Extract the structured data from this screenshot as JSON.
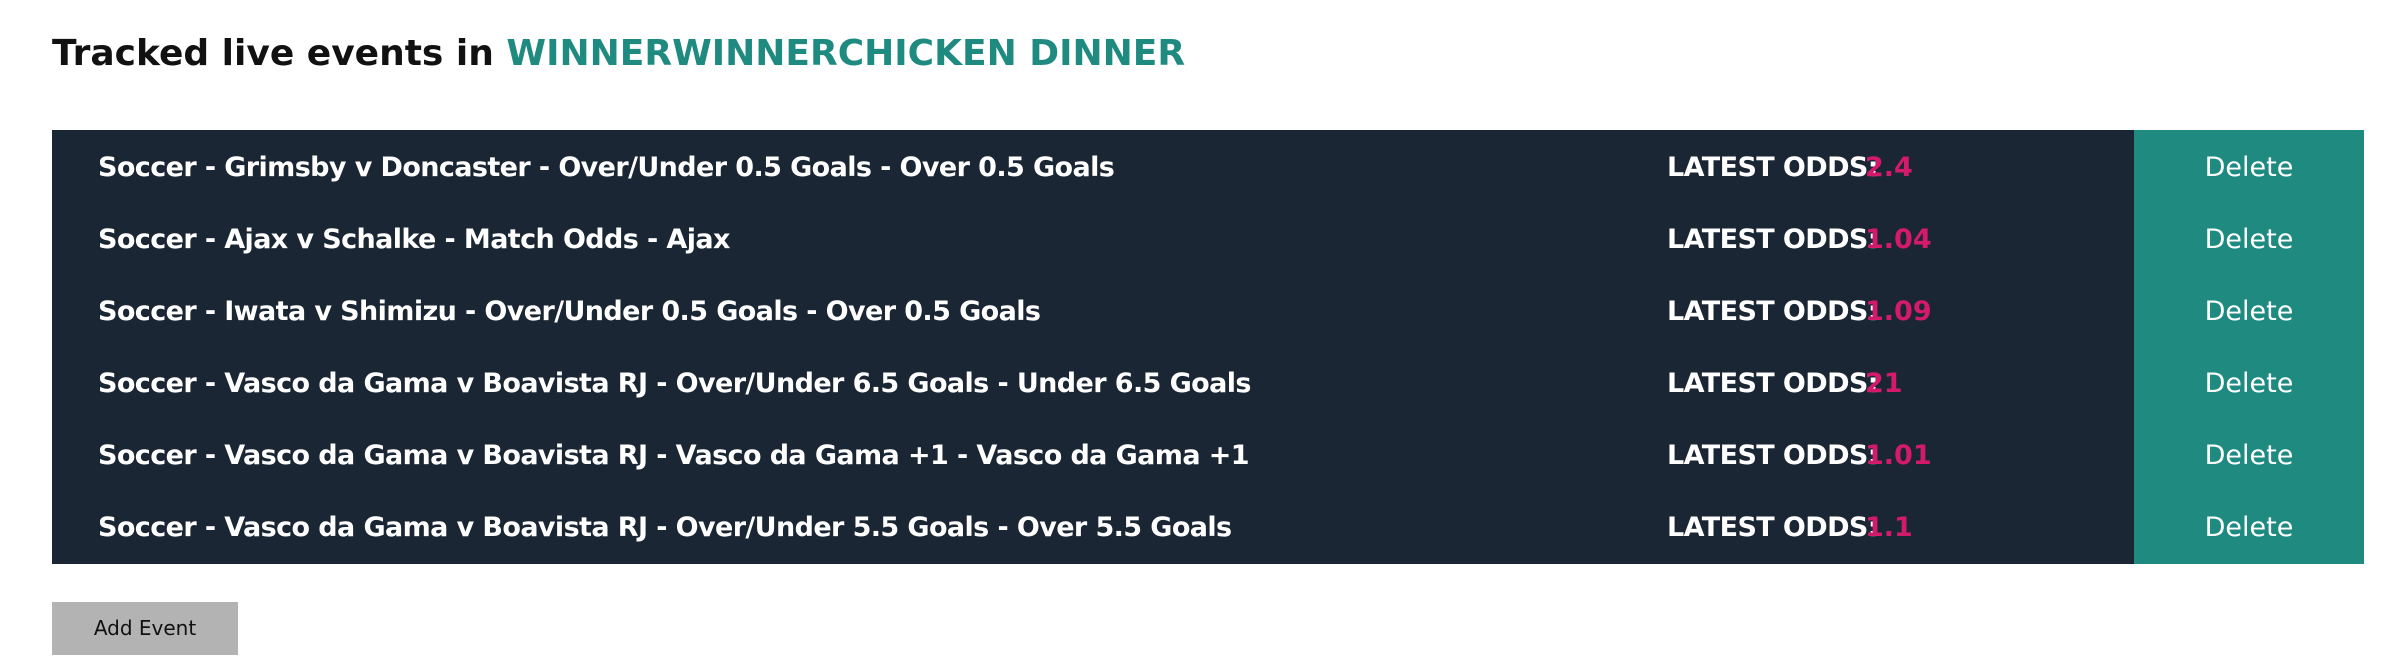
{
  "header": {
    "title_prefix": "Tracked live events in",
    "title_highlight": "WINNERWINNERCHICKEN DINNER"
  },
  "events": [
    {
      "name": "Soccer - Grimsby v Doncaster - Over/Under 0.5 Goals - Over 0.5 Goals",
      "odds_label": "LATEST ODDS:",
      "odds": "2.4",
      "delete_label": "Delete"
    },
    {
      "name": "Soccer - Ajax v Schalke - Match Odds - Ajax",
      "odds_label": "LATEST ODDS:",
      "odds": "1.04",
      "delete_label": "Delete"
    },
    {
      "name": "Soccer - Iwata v Shimizu - Over/Under 0.5 Goals - Over 0.5 Goals",
      "odds_label": "LATEST ODDS:",
      "odds": "1.09",
      "delete_label": "Delete"
    },
    {
      "name": "Soccer - Vasco da Gama v Boavista RJ - Over/Under 6.5 Goals - Under 6.5 Goals",
      "odds_label": "LATEST ODDS:",
      "odds": "21",
      "delete_label": "Delete"
    },
    {
      "name": "Soccer - Vasco da Gama v Boavista RJ - Vasco da Gama +1 - Vasco da Gama +1",
      "odds_label": "LATEST ODDS:",
      "odds": "1.01",
      "delete_label": "Delete"
    },
    {
      "name": "Soccer - Vasco da Gama v Boavista RJ - Over/Under 5.5 Goals - Over 5.5 Goals",
      "odds_label": "LATEST ODDS:",
      "odds": "1.1",
      "delete_label": "Delete"
    }
  ],
  "actions": {
    "add_event_label": "Add Event"
  },
  "colors": {
    "accent": "#1f8a80",
    "table_background": "#1a2633",
    "odds_value": "#d41a6a",
    "add_button_background": "#b3b3b3"
  }
}
